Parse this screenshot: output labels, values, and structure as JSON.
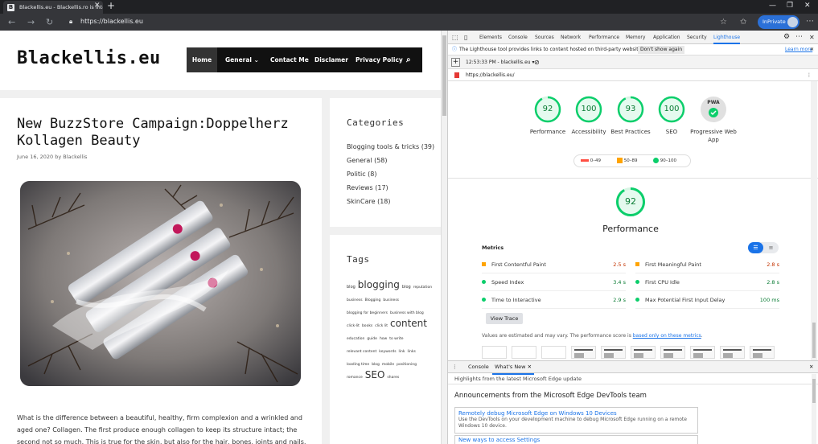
{
  "browser": {
    "tab_title": "Blackellis.eu - Blackellis.ro is inte",
    "tab_favicon": "B",
    "url": "https://blackellis.eu",
    "inprivate_label": "InPrivate"
  },
  "site": {
    "logo": "Blackellis.eu",
    "nav": [
      {
        "label": "Home"
      },
      {
        "label": "General"
      },
      {
        "label": "Contact Me"
      },
      {
        "label": "Disclamer"
      },
      {
        "label": "Privacy Policy"
      }
    ],
    "post": {
      "title": "New BuzzStore Campaign:Doppelherz Kollagen Beauty",
      "meta": "June 16, 2020 by Blackellis",
      "text": "What is the difference between a beautiful, healthy, firm complexion and a wrinkled and aged one? Collagen. The first produce enough collagen to keep its structure intact; the second not so much. This is true for the skin, but also for the hair, bones, joints and nails, which grow faster and"
    },
    "categories_title": "Categories",
    "categories": [
      "Blogging tools & tricks (39)",
      "General (58)",
      "Politic (8)",
      "Reviews (17)",
      "SkinCare (18)"
    ],
    "tags_title": "Tags",
    "tags": [
      {
        "text": "blog",
        "size": 5
      },
      {
        "text": "blogging",
        "size": 12
      },
      {
        "text": "blog",
        "size": 5
      },
      {
        "text": "reputation",
        "size": 4.5
      },
      {
        "text": "business",
        "size": 4.5
      },
      {
        "text": "Blogging",
        "size": 4.5
      },
      {
        "text": "business",
        "size": 4.5
      },
      {
        "text": "blogging for beginners",
        "size": 4.5
      },
      {
        "text": "business with blog",
        "size": 4.5
      },
      {
        "text": "click-lit",
        "size": 4.5
      },
      {
        "text": "books",
        "size": 4.5
      },
      {
        "text": "click lit",
        "size": 4.5
      },
      {
        "text": "content",
        "size": 12
      },
      {
        "text": "education",
        "size": 4.5
      },
      {
        "text": "guide",
        "size": 4.5
      },
      {
        "text": "how",
        "size": 4.5
      },
      {
        "text": "to write",
        "size": 4.5
      },
      {
        "text": "relevant content",
        "size": 4.5
      },
      {
        "text": "keywords",
        "size": 4.5
      },
      {
        "text": "link",
        "size": 4.5
      },
      {
        "text": "links",
        "size": 4.5
      },
      {
        "text": "loading time",
        "size": 4.5
      },
      {
        "text": "blog",
        "size": 4.5
      },
      {
        "text": "mobile",
        "size": 4.5
      },
      {
        "text": "positioning",
        "size": 4.5
      },
      {
        "text": "romance",
        "size": 4.5
      },
      {
        "text": "SEO",
        "size": 12
      },
      {
        "text": "shares",
        "size": 4.5
      }
    ]
  },
  "devtools": {
    "tabs": [
      "Elements",
      "Console",
      "Sources",
      "Network",
      "Performance",
      "Memory",
      "Application",
      "Security",
      "Lighthouse"
    ],
    "infobar_text": "The Lighthouse tool provides links to content hosted on third-party websites.",
    "infobar_button": "Don't show again",
    "infobar_link": "Learn more",
    "report_time": "12:53:33 PM - blackellis.eu",
    "report_url": "https://blackellis.eu/",
    "scores": [
      {
        "label": "Performance",
        "value": "92"
      },
      {
        "label": "Accessibility",
        "value": "100"
      },
      {
        "label": "Best Practices",
        "value": "93"
      },
      {
        "label": "SEO",
        "value": "100"
      },
      {
        "label": "Progressive Web App",
        "value": "PWA"
      }
    ],
    "legend": [
      "0–49",
      "50–89",
      "90–100"
    ],
    "perf_score": "92",
    "perf_title": "Performance",
    "metrics_title": "Metrics",
    "metrics": [
      {
        "name": "First Contentful Paint",
        "value": "2.5 s",
        "status": "orange"
      },
      {
        "name": "First Meaningful Paint",
        "value": "2.8 s",
        "status": "orange"
      },
      {
        "name": "Speed Index",
        "value": "3.4 s",
        "status": "green"
      },
      {
        "name": "First CPU Idle",
        "value": "2.8 s",
        "status": "green"
      },
      {
        "name": "Time to Interactive",
        "value": "2.9 s",
        "status": "green"
      },
      {
        "name": "Max Potential First Input Delay",
        "value": "100 ms",
        "status": "green"
      }
    ],
    "view_trace": "View Trace",
    "note": "Values are estimated and may vary. The performance score is ",
    "note_link": "based only on these metrics",
    "drawer_tabs": [
      "Console",
      "What's New"
    ],
    "highlights": "Highlights from the latest Microsoft Edge update",
    "announcements": "Announcements from the Microsoft Edge DevTools team",
    "cards": [
      {
        "title": "Remotely debug Microsoft Edge on Windows 10 Devices",
        "body": "Use the DevTools on your development machine to debug Microsoft Edge running on a remote Windows 10 device."
      },
      {
        "title": "New ways to access Settings",
        "body": ""
      }
    ],
    "colors": {
      "green": "#0cce6b",
      "orange": "#ffa400",
      "red": "#ff4e42",
      "accent": "#1a73e8"
    }
  }
}
